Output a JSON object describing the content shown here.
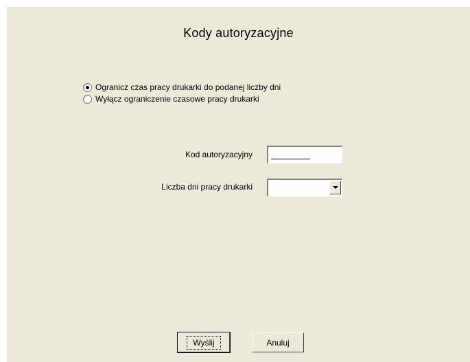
{
  "dialog": {
    "title": "Kody autoryzacyjne"
  },
  "options": [
    {
      "label": "Ogranicz czas pracy drukarki do podanej liczby dni",
      "selected": true
    },
    {
      "label": "Wyłącz ograniczenie czasowe pracy drukarki",
      "selected": false
    }
  ],
  "form": {
    "auth_code_label": "Kod autoryzacyjny",
    "auth_code_value": "",
    "days_label": "Liczba dni pracy drukarki",
    "days_value": ""
  },
  "buttons": {
    "submit_label": "Wyślij",
    "cancel_label": "Anuluj"
  }
}
